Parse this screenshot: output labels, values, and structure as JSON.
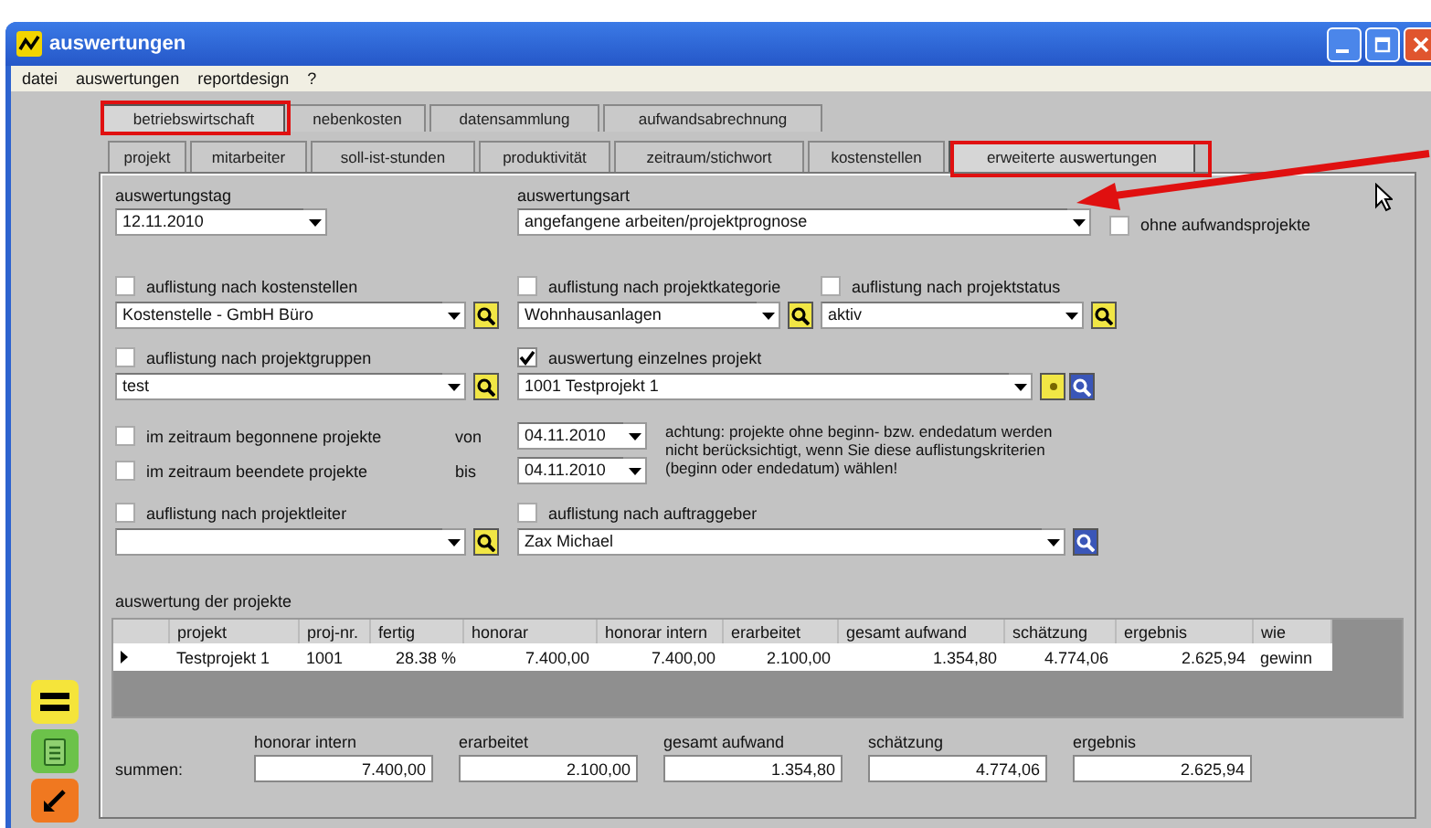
{
  "window": {
    "title": "auswertungen"
  },
  "menu": [
    "datei",
    "auswertungen",
    "reportdesign",
    "?"
  ],
  "tabs_primary": [
    {
      "label": "betriebswirtschaft",
      "selected": true
    },
    {
      "label": "nebenkosten",
      "selected": false
    },
    {
      "label": "datensammlung",
      "selected": false
    },
    {
      "label": "aufwandsabrechnung",
      "selected": false
    }
  ],
  "tabs_secondary": [
    {
      "label": "projekt",
      "selected": false
    },
    {
      "label": "mitarbeiter",
      "selected": false
    },
    {
      "label": "soll-ist-stunden",
      "selected": false
    },
    {
      "label": "produktivität",
      "selected": false
    },
    {
      "label": "zeitraum/stichwort",
      "selected": false
    },
    {
      "label": "kostenstellen",
      "selected": false
    },
    {
      "label": "erweiterte auswertungen",
      "selected": true
    }
  ],
  "evaluation_date": {
    "label": "auswertungstag",
    "value": "12.11.2010"
  },
  "evaluation_type": {
    "label": "auswertungsart",
    "value": "angefangene arbeiten/projektprognose"
  },
  "without_effort_projects": {
    "label": "ohne aufwandsprojekte",
    "checked": false
  },
  "cost_center": {
    "label": "auflistung nach kostenstellen",
    "checked": false,
    "value": "Kostenstelle - GmbH Büro",
    "buttons": [
      {
        "kind": "search"
      }
    ]
  },
  "project_category": {
    "label": "auflistung nach projektkategorie",
    "checked": false,
    "value": "Wohnhausanlagen",
    "buttons": [
      {
        "kind": "search"
      }
    ]
  },
  "project_status": {
    "label": "auflistung nach projektstatus",
    "checked": false,
    "value": "aktiv",
    "buttons": [
      {
        "kind": "search"
      }
    ]
  },
  "project_group": {
    "label": "auflistung nach projektgruppen",
    "checked": false,
    "value": "test",
    "buttons": [
      {
        "kind": "search"
      }
    ]
  },
  "single_project": {
    "label": "auswertung einzelnes projekt",
    "checked": true,
    "value": "1001  Testprojekt 1",
    "buttons": [
      {
        "kind": "select"
      },
      {
        "kind": "search_alt"
      }
    ]
  },
  "started_in_period": {
    "label": "im zeitraum begonnene projekte",
    "checked": false
  },
  "ended_in_period": {
    "label": "im zeitraum beendete projekte",
    "checked": false
  },
  "period_from": {
    "label": "von",
    "value": "04.11.2010"
  },
  "period_to": {
    "label": "bis",
    "value": "04.11.2010"
  },
  "period_note": "achtung: projekte ohne beginn- bzw. endedatum werden nicht berücksichtigt, wenn Sie diese auflistungskriterien (beginn oder endedatum) wählen!",
  "project_lead": {
    "label": "auflistung nach projektleiter",
    "checked": false,
    "buttons": [
      {
        "kind": "search"
      }
    ]
  },
  "client": {
    "label": "auflistung nach auftraggeber",
    "checked": false,
    "value": "Zax Michael",
    "buttons": [
      {
        "kind": "search_alt"
      }
    ]
  },
  "table": {
    "title": "auswertung der projekte",
    "columns": [
      "projekt",
      "proj-nr.",
      "fertig",
      "honorar",
      "honorar intern",
      "erarbeitet",
      "gesamt aufwand",
      "schätzung",
      "ergebnis",
      "wie"
    ],
    "rows": [
      {
        "current": true,
        "cells": [
          "Testprojekt 1",
          "1001",
          "28.38 %",
          "7.400,00",
          "7.400,00",
          "2.100,00",
          "1.354,80",
          "4.774,06",
          "2.625,94",
          "gewinn"
        ]
      }
    ]
  },
  "totals": {
    "label": "summen:",
    "items": [
      {
        "label": "honorar intern",
        "value": "7.400,00"
      },
      {
        "label": "erarbeitet",
        "value": "2.100,00"
      },
      {
        "label": "gesamt aufwand",
        "value": "1.354,80"
      },
      {
        "label": "schätzung",
        "value": "4.774,06"
      },
      {
        "label": "ergebnis",
        "value": "2.625,94"
      }
    ]
  }
}
